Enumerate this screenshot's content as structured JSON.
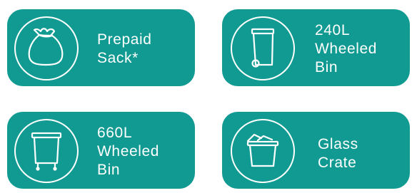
{
  "colors": {
    "card_background": "#109a92",
    "card_foreground": "#ffffff",
    "page_background": "#ffffff"
  },
  "options": [
    {
      "label": "Prepaid\nSack*",
      "icon": "sack-icon"
    },
    {
      "label": "240L\nWheeled\nBin",
      "icon": "wheeled-bin-icon"
    },
    {
      "label": "660L\nWheeled\nBin",
      "icon": "large-wheeled-bin-icon"
    },
    {
      "label": "Glass\nCrate",
      "icon": "glass-crate-icon"
    }
  ]
}
